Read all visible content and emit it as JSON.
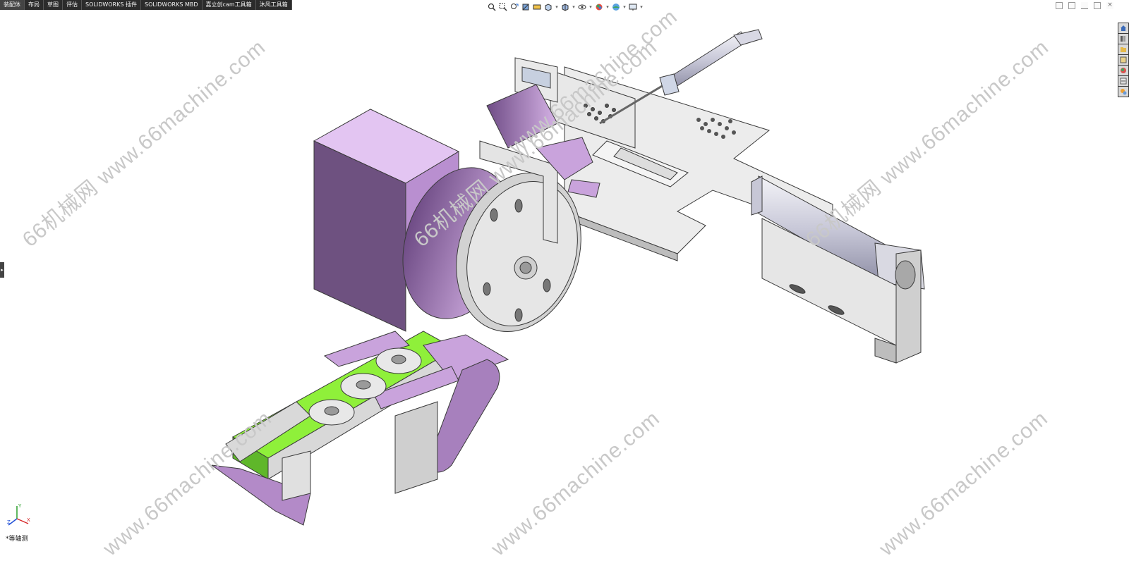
{
  "tabs": [
    {
      "label": "装配体"
    },
    {
      "label": "布局"
    },
    {
      "label": "草图"
    },
    {
      "label": "评估"
    },
    {
      "label": "SOLIDWORKS 插件"
    },
    {
      "label": "SOLIDWORKS MBD"
    },
    {
      "label": "嘉立创cam工具箱"
    },
    {
      "label": "沐风工具箱"
    }
  ],
  "heads_up_toolbar": {
    "icons": [
      "zoom-to-fit-icon",
      "zoom-to-area-icon",
      "previous-view-icon",
      "section-view-icon",
      "dynamic-annotation-icon",
      "view-orientation-icon",
      "display-style-icon",
      "hide-show-items-icon",
      "edit-appearance-icon",
      "apply-scene-icon",
      "view-settings-icon"
    ]
  },
  "task_pane": {
    "icons": [
      "home-icon",
      "design-library-icon",
      "file-explorer-icon",
      "view-palette-icon",
      "appearances-icon",
      "custom-properties-icon",
      "forum-icon"
    ]
  },
  "watermark": {
    "texts": [
      "66机械网 www.66machine.com",
      "www.66machine.com",
      "66机械网 www.66machine.com",
      "66机械网 www.66machine.com",
      "www.66machine.com",
      "www.66machine.com",
      "www.66machine.com"
    ]
  },
  "view": {
    "orientation_label": "*等轴测"
  },
  "triad": {
    "x": "X",
    "y": "Y",
    "z": "Z"
  },
  "colors": {
    "part_gray": "#e2e2e2",
    "part_edge": "#3a3a3a",
    "part_purple": "#c9a3dc",
    "part_purple_dark": "#7e5a93",
    "belt_green": "#8ff03a",
    "tab_bar": "#2b2b2b"
  }
}
